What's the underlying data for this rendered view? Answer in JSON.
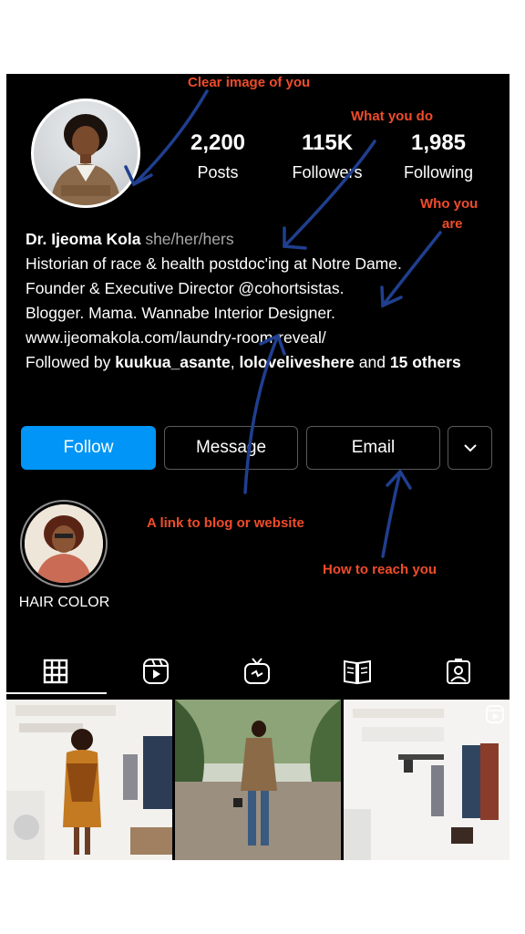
{
  "profile": {
    "stats": [
      {
        "value": "2,200",
        "label": "Posts"
      },
      {
        "value": "115K",
        "label": "Followers"
      },
      {
        "value": "1,985",
        "label": "Following"
      }
    ],
    "name": "Dr. Ijeoma Kola",
    "pronouns": "she/her/hers",
    "bio_line1": "Historian of race & health postdoc'ing at Notre Dame.",
    "bio_line2": "Founder & Executive Director @cohortsistas.",
    "bio_line3": "Blogger. Mama. Wannabe Interior Designer.",
    "website": "www.ijeomakola.com/laundry-room-reveal/",
    "followed_by_prefix": "Followed by",
    "followed_by_user1": "kuukua_asante",
    "followed_by_user2": "loloveliveshere",
    "followed_by_and": "and",
    "followed_by_others": "15 others"
  },
  "buttons": {
    "follow": "Follow",
    "message": "Message",
    "email": "Email"
  },
  "highlights": [
    {
      "label": "HAIR COLOR"
    }
  ],
  "tabs": [
    "grid-icon",
    "reels-icon",
    "igtv-icon",
    "guides-icon",
    "tagged-icon"
  ],
  "annotations": {
    "clear_image": "Clear image of you",
    "what_you_do": "What you do",
    "who_you_are_1": "Who you",
    "who_you_are_2": "are",
    "link": "A link to blog or website",
    "reach": "How to reach you"
  },
  "colors": {
    "annotation_text": "#f04c2a",
    "annotation_arrow": "#1f3f8f",
    "follow_button": "#0095f6"
  }
}
